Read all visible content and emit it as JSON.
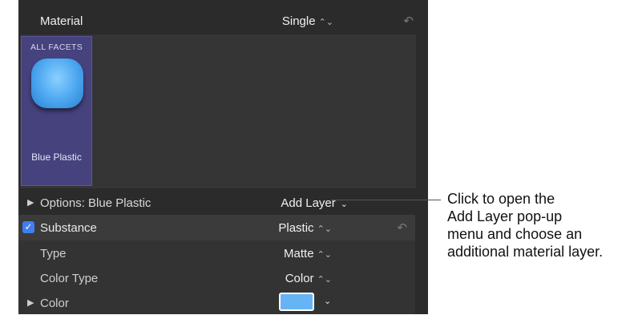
{
  "header": {
    "label": "Material",
    "mode_value": "Single",
    "updown_glyph": "⌃⌄",
    "reset_glyph": "↶"
  },
  "facets": {
    "caption": "ALL FACETS",
    "material_name": "Blue Plastic",
    "swatch_color": "#4ba6ef"
  },
  "options": {
    "disclosure_glyph": "▶",
    "label": "Options: Blue Plastic",
    "add_layer_label": "Add Layer",
    "chevron_glyph": "⌄"
  },
  "substance": {
    "checked": true,
    "check_glyph": "✓",
    "label": "Substance",
    "value": "Plastic",
    "updown_glyph": "⌃⌄",
    "reset_glyph": "↶"
  },
  "properties": [
    {
      "label": "Type",
      "value": "Matte",
      "updown_glyph": "⌃⌄"
    },
    {
      "label": "Color Type",
      "value": "Color",
      "updown_glyph": "⌃⌄"
    }
  ],
  "color": {
    "disclosure_glyph": "▶",
    "label": "Color",
    "swatch_color": "#67b4f5",
    "chevron_glyph": "⌄"
  },
  "callout": {
    "lines": [
      "Click to open the",
      "Add Layer pop-up",
      "menu and choose an",
      "additional material layer."
    ]
  }
}
